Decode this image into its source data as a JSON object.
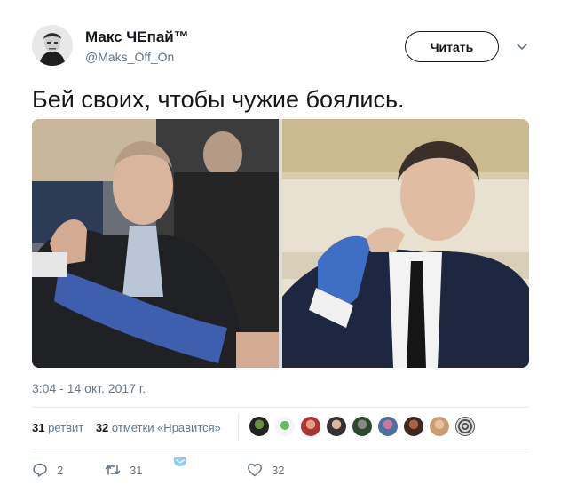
{
  "author": {
    "name": "Макс ЧЕпай™",
    "handle": "@Maks_Off_On"
  },
  "follow_label": "Читать",
  "tweet_text": "Бей своих, чтобы чужие боялись.",
  "timestamp": "3:04 - 14 окт. 2017 г.",
  "stats": {
    "retweets_count": "31",
    "retweets_label": "ретвит",
    "likes_count": "32",
    "likes_label": "отметки «Нравится»"
  },
  "actions": {
    "replies": "2",
    "retweets": "31",
    "likes": "32"
  },
  "icons": [
    "chevron-down-icon",
    "reply-icon",
    "retweet-icon",
    "direct-message-icon",
    "heart-icon"
  ],
  "colors": {
    "text": "#14171a",
    "secondary": "#657786",
    "divider": "#e6ecf0",
    "dm_icon": "#8ecdf8"
  }
}
